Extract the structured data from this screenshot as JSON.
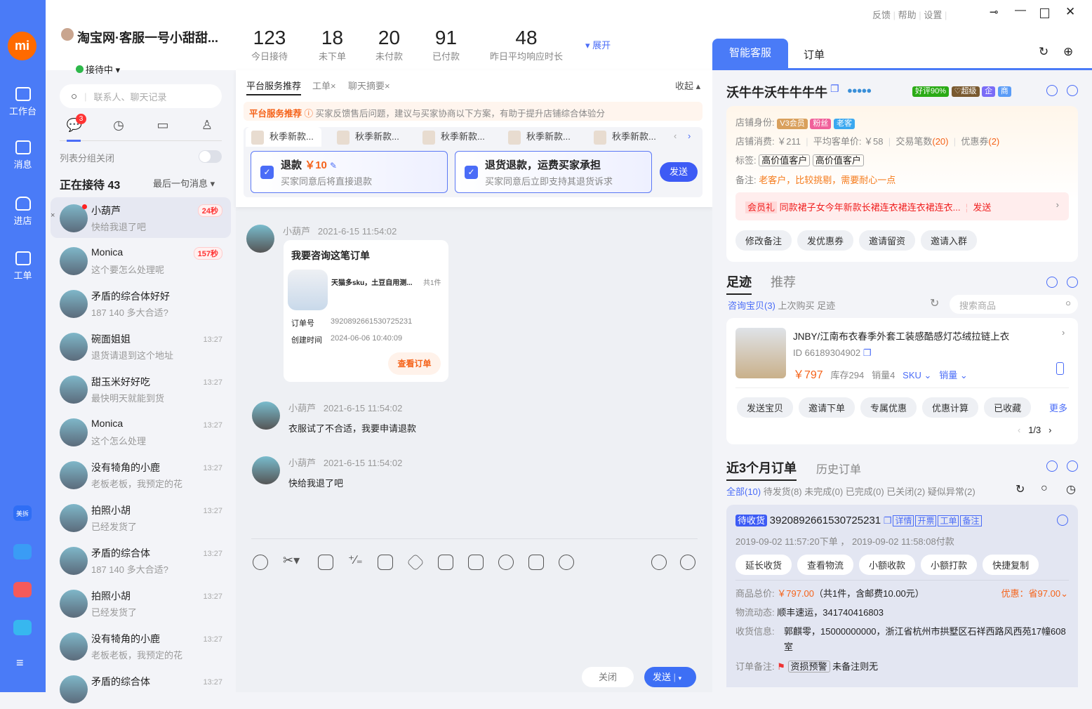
{
  "rail": {
    "logo": "mi",
    "items": [
      {
        "label": "工作台",
        "icon": "workbench-icon"
      },
      {
        "label": "消息",
        "icon": "mail-icon"
      },
      {
        "label": "进店",
        "icon": "store-icon"
      },
      {
        "label": "工单",
        "icon": "ticket-icon"
      }
    ],
    "apps": [
      {
        "label": "美拆",
        "color": "#2f6ef5"
      },
      {
        "label": "",
        "color": "#3a9cf5"
      },
      {
        "label": "",
        "color": "#f55a5a"
      },
      {
        "label": "",
        "color": "#37b7ef"
      }
    ],
    "accent": "#4a7bf7"
  },
  "account": {
    "name": "淘宝网·客服一号小甜甜...",
    "status": "接待中"
  },
  "contacts": {
    "search_placeholder": "联系人、聊天记录",
    "badge": "3",
    "group_label": "列表分组关闭",
    "group_on": false,
    "title": "正在接待 43",
    "sort": "最后一句消息",
    "items": [
      {
        "name": "小葫芦",
        "msg": "快给我退了吧",
        "time": "24秒",
        "urgent": true
      },
      {
        "name": "Monica",
        "msg": "这个要怎么处理呢",
        "time": "157秒",
        "urgent": true
      },
      {
        "name": "矛盾的综合体好好",
        "msg": "187 140 多大合适?",
        "time": ""
      },
      {
        "name": "碗面姐姐",
        "msg": "退货请退到这个地址",
        "time": "13:27"
      },
      {
        "name": "甜玉米好好吃",
        "msg": "最快明天就能到货",
        "time": "13:27"
      },
      {
        "name": "Monica",
        "msg": "这个怎么处理",
        "time": "13:27"
      },
      {
        "name": "没有犄角的小鹿",
        "msg": "老板老板，我预定的花",
        "time": "13:27"
      },
      {
        "name": "拍照小胡",
        "msg": "已经发货了",
        "time": "13:27"
      },
      {
        "name": "矛盾的综合体",
        "msg": "187 140 多大合适?",
        "time": "13:27"
      },
      {
        "name": "拍照小胡",
        "msg": "已经发货了",
        "time": "13:27"
      },
      {
        "name": "没有犄角的小鹿",
        "msg": "老板老板，我预定的花",
        "time": "13:27"
      },
      {
        "name": "矛盾的综合体",
        "msg": "",
        "time": "13:27"
      }
    ]
  },
  "stats": [
    {
      "value": "123",
      "label": "今日接待"
    },
    {
      "value": "18",
      "label": "未下单"
    },
    {
      "value": "20",
      "label": "未付款"
    },
    {
      "value": "91",
      "label": "已付款"
    },
    {
      "value": "48",
      "label": "昨日平均响应时长"
    }
  ],
  "stats_expand": "展开",
  "window": {
    "feedback": "反馈",
    "help": "帮助",
    "settings": "设置"
  },
  "rec": {
    "tabs": [
      "平台服务推荐",
      "工单×",
      "聊天摘要×"
    ],
    "collapse": "收起",
    "banner_title": "平台服务推荐",
    "banner_text": "买家反馈售后问题，建议与买家协商以下方案，有助于提升店铺综合体验分",
    "products": [
      "秋季新款...",
      "秋季新款...",
      "秋季新款...",
      "秋季新款...",
      "秋季新款..."
    ],
    "options": [
      {
        "title": "退款",
        "amount": "￥10",
        "desc": "买家同意后将直接退款"
      },
      {
        "title": "退货退款，运费买家承担",
        "amount": "",
        "desc": "买家同意后立即支持其退货诉求"
      }
    ],
    "send": "发送"
  },
  "chat": {
    "messages": [
      {
        "sender": "小葫芦",
        "time": "2021-6-15 11:54:02",
        "card": {
          "title": "我要咨询这笔订单",
          "product": "天猫多sku，土豆自用测...",
          "count": "共1件",
          "order_label": "订单号",
          "order_no": "3920892661530725231",
          "created_label": "创建时间",
          "created": "2024-06-06 10:40:09",
          "button": "查看订单"
        }
      },
      {
        "sender": "小葫芦",
        "time": "2021-6-15 11:54:02",
        "text": "衣服试了不合适，我要申请退款"
      },
      {
        "sender": "小葫芦",
        "time": "2021-6-15 11:54:02",
        "text": "快给我退了吧"
      }
    ],
    "close": "关闭",
    "send": "发送"
  },
  "right": {
    "tabs": [
      "智能客服",
      "订单"
    ],
    "customer": {
      "name": "沃牛牛沃牛牛牛牛",
      "rating": "好评90%",
      "level": "超级",
      "t1": "企",
      "t2": "商",
      "identity_label": "店铺身份:",
      "ids": [
        "V3会员",
        "粉丝",
        "老客"
      ],
      "spend": "店铺消费: ￥211",
      "avg": "平均客单价: ￥58",
      "trades_label": "交易笔数",
      "trades": "(20)",
      "coupons_label": "优惠券",
      "coupons": "(2)",
      "tags_label": "标签:",
      "tags": [
        "高价值客户",
        "高价值客户"
      ],
      "note_label": "备注:",
      "note": "老客户，比较挑剔，需要耐心一点",
      "gift_tag": "会员礼",
      "gift": "同款裙子女今年新款长裙连衣裙连衣裙连衣...",
      "gift_send": "发送",
      "actions": [
        "修改备注",
        "发优惠券",
        "邀请留资",
        "邀请入群"
      ]
    },
    "footprint": {
      "tabs": [
        "足迹",
        "推荐"
      ],
      "filters": [
        "咨询宝贝(3)",
        "上次购买",
        "足迹"
      ],
      "search_placeholder": "搜索商品",
      "product": {
        "title": "JNBY/江南布衣春季外套工装感酷感灯芯绒拉链上衣",
        "id": "ID 66189304902",
        "price": "￥797",
        "stock": "库存294",
        "sales": "销量4",
        "sku": "SKU",
        "sales_sort": "销量"
      },
      "actions": [
        "发送宝贝",
        "邀请下单",
        "专属优惠",
        "优惠计算",
        "已收藏"
      ],
      "more": "更多",
      "page": "1/3"
    },
    "orders": {
      "tabs": [
        "近3个月订单",
        "历史订单"
      ],
      "filters": [
        "全部(10)",
        "待发货(8)",
        "未完成(0)",
        "已完成(0)",
        "已关闭(2)",
        "疑似异常(2)"
      ],
      "status": "待收货",
      "order_no": "3920892661530725231",
      "links": [
        "详情",
        "开票",
        "工单",
        "备注"
      ],
      "times": "2019-09-02 11:57:20下单 ， 2019-09-02 11:58:08付款",
      "actions": [
        "延长收货",
        "查看物流",
        "小额收款",
        "小额打款",
        "快捷复制"
      ],
      "total_label": "商品总价:",
      "total": "￥797.00",
      "total_detail": "（共1件，含邮费10.00元）",
      "discount": "优惠：省97.00",
      "logistics_label": "物流动态:",
      "logistics": "顺丰速运，341740416803",
      "address_label": "收货信息:",
      "address": "郭麒零，15000000000，浙江省杭州市拱墅区石祥西路风西苑17幢608室",
      "remark_label": "订单备注:",
      "remark_tag": "资损预警",
      "remark": "未备注则无"
    }
  }
}
